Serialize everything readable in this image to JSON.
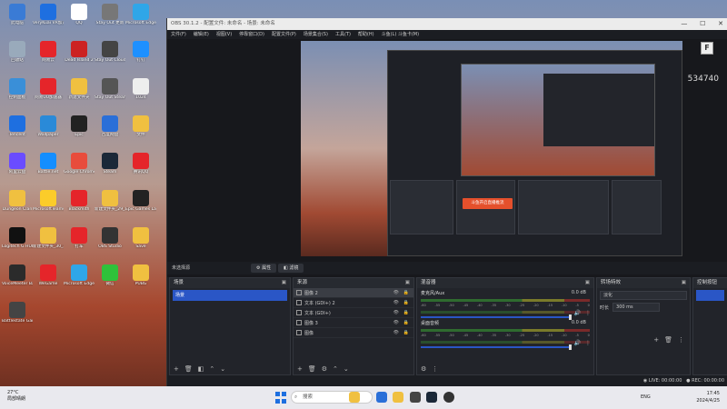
{
  "desktop": {
    "icons": [
      {
        "label": "此电脑",
        "color": "#3a7bd5"
      },
      {
        "label": "VeryKuai VR加速器",
        "color": "#1e6fe0"
      },
      {
        "label": "QQ",
        "color": "#ffffff"
      },
      {
        "label": "Stay Out 更新",
        "color": "#777777"
      },
      {
        "label": "Microsoft Edge",
        "color": "#2fa6e8"
      },
      {
        "label": "回收站",
        "color": "#9ab"
      },
      {
        "label": "网易云",
        "color": "#e5252a"
      },
      {
        "label": "Dead Island 2",
        "color": "#cc2222"
      },
      {
        "label": "Stay Out Cloud",
        "color": "#444"
      },
      {
        "label": "钉钉",
        "color": "#1e90ff"
      },
      {
        "label": "控制面板",
        "color": "#3a8fd8"
      },
      {
        "label": "网易UU加速器",
        "color": "#e5252a"
      },
      {
        "label": "新建文件夹",
        "color": "#f0c040"
      },
      {
        "label": "Stay Out Steam",
        "color": "#555"
      },
      {
        "label": "1024",
        "color": "#eee"
      },
      {
        "label": "Tencent",
        "color": "#1e6fe0"
      },
      {
        "label": "Wallpaper",
        "color": "#2a8ad8"
      },
      {
        "label": "Epic",
        "color": "#222"
      },
      {
        "label": "百度网盘",
        "color": "#2a6fd8"
      },
      {
        "label": "文件",
        "color": "#f0c040"
      },
      {
        "label": "阿里云盘",
        "color": "#6a4cff"
      },
      {
        "label": "Battle.net",
        "color": "#148eff"
      },
      {
        "label": "Google Chrome",
        "color": "#e84c3c"
      },
      {
        "label": "Steam",
        "color": "#1b2838"
      },
      {
        "label": "腾讯QQ",
        "color": "#e5252a"
      },
      {
        "label": "Dungeon Clan",
        "color": "#f0c040"
      },
      {
        "label": "MicrosoftTeams",
        "color": "#fbcc2a"
      },
      {
        "label": "Blackmith",
        "color": "#e5252a"
      },
      {
        "label": "新建文件夹_29_2023",
        "color": "#f0c040"
      },
      {
        "label": "Epic Games Launcher",
        "color": "#222"
      },
      {
        "label": "Logitech G HUB",
        "color": "#111"
      },
      {
        "label": "新建文件夹_30_2023",
        "color": "#f0c040"
      },
      {
        "label": "打车",
        "color": "#e5252a"
      },
      {
        "label": "OBS Studio",
        "color": "#333"
      },
      {
        "label": "Save",
        "color": "#f0c040"
      },
      {
        "label": "VoiceMeeter Banana",
        "color": "#2b2b2b"
      },
      {
        "label": "WeGame",
        "color": "#e5252a"
      },
      {
        "label": "Microsoft Edge",
        "color": "#2fa6e8"
      },
      {
        "label": "微信",
        "color": "#2ec23a"
      },
      {
        "label": "PUBG",
        "color": "#f0c040"
      },
      {
        "label": "Battlestate Games L...",
        "color": "#444"
      }
    ]
  },
  "obs": {
    "title": "OBS 30.1.2 - 配置文件: 未命名 - 场景: 未命名",
    "menu": [
      "文件(F)",
      "编辑(E)",
      "视图(V)",
      "停靠窗口(D)",
      "配置文件(P)",
      "场景集合(S)",
      "工具(T)",
      "帮助(H)",
      "斗鱼(L) 斗鱼卡(M)"
    ],
    "preview": {
      "counter": "534740",
      "logo": "F",
      "nested_button": "斗鱼开启直播推流"
    },
    "scene_bar": {
      "label": "未选择源",
      "settings_button": "属性",
      "filters_button": "滤镜"
    },
    "docks": {
      "scenes": {
        "title": "场景",
        "items": [
          "场景"
        ]
      },
      "sources": {
        "title": "来源",
        "items": [
          {
            "label": "图像 2",
            "selected": true
          },
          {
            "label": "文本 (GDI+) 2",
            "selected": false
          },
          {
            "label": "文本 (GDI+)",
            "selected": false
          },
          {
            "label": "图像 3",
            "selected": false
          },
          {
            "label": "图像",
            "selected": false
          }
        ]
      },
      "mixer": {
        "title": "混音器",
        "channels": [
          {
            "name": "麦克风/Aux",
            "db": "0.0 dB"
          },
          {
            "name": "桌面音频",
            "db": "0.0 dB"
          }
        ],
        "scale": [
          "-60",
          "-55",
          "-50",
          "-45",
          "-40",
          "-35",
          "-30",
          "-25",
          "-20",
          "-15",
          "-10",
          "-5",
          "0"
        ]
      },
      "transitions": {
        "title": "转场特效",
        "type": "淡化",
        "duration_label": "时长",
        "duration_value": "300 ms"
      },
      "controls": {
        "title": "控制按钮"
      }
    },
    "status": {
      "live": "LIVE: 00:00:00",
      "rec": "REC: 00:00:00"
    }
  },
  "taskbar": {
    "weather_temp": "27°C",
    "weather_desc": "局部晴朗",
    "search_placeholder": "搜索",
    "lang": "ENG",
    "time": "17:45",
    "date": "2024/4/25"
  }
}
